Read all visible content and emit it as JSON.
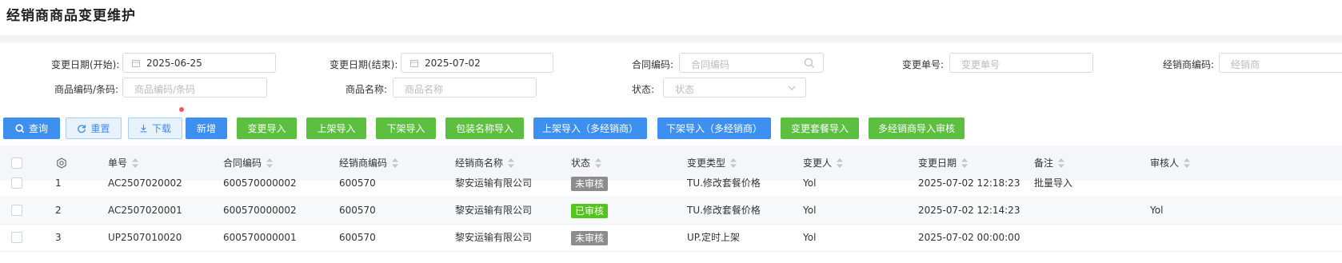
{
  "page": {
    "title": "经销商商品变更维护"
  },
  "filters": {
    "start_date": {
      "label": "变更日期(开始):",
      "value": "2025-06-25"
    },
    "end_date": {
      "label": "变更日期(结束):",
      "value": "2025-07-02"
    },
    "contract_code": {
      "label": "合同编码:",
      "placeholder": "合同编码"
    },
    "change_no": {
      "label": "变更单号:",
      "placeholder": "变更单号"
    },
    "dealer_code": {
      "label": "经销商编码:",
      "placeholder": "经销商"
    },
    "product_code": {
      "label": "商品编码/条码:",
      "placeholder": "商品编码/条码"
    },
    "product_name": {
      "label": "商品名称:",
      "placeholder": "商品名称"
    },
    "status": {
      "label": "状态:",
      "placeholder": "状态"
    }
  },
  "toolbar": {
    "query": "查询",
    "reset": "重置",
    "download": "下载",
    "add": "新增",
    "change_import": "变更导入",
    "shelf_on_import": "上架导入",
    "shelf_off_import": "下架导入",
    "package_name_import": "包装名称导入",
    "shelf_on_multi_import": "上架导入（多经销商）",
    "shelf_off_multi_import": "下架导入（多经销商）",
    "change_package_import": "变更套餐导入",
    "multi_dealer_import_review": "多经销商导入审核"
  },
  "table": {
    "headers": {
      "no": "单号",
      "contract": "合同编码",
      "dealer_code": "经销商编码",
      "dealer_name": "经销商名称",
      "status": "状态",
      "change_type": "变更类型",
      "changer": "变更人",
      "change_date": "变更日期",
      "remark": "备注",
      "reviewer": "审核人"
    },
    "rows": [
      {
        "idx": "1",
        "no": "AC2507020002",
        "contract": "600570000002",
        "dealer_code": "600570",
        "dealer_name": "黎安运输有限公司",
        "status": "未审核",
        "change_type": "TU.修改套餐价格",
        "changer": "Yol",
        "change_date": "2025-07-02 12:18:23",
        "remark": "批量导入",
        "reviewer": ""
      },
      {
        "idx": "2",
        "no": "AC2507020001",
        "contract": "600570000002",
        "dealer_code": "600570",
        "dealer_name": "黎安运输有限公司",
        "status": "已审核",
        "change_type": "TU.修改套餐价格",
        "changer": "Yol",
        "change_date": "2025-07-02 12:14:23",
        "remark": "",
        "reviewer": "Yol"
      },
      {
        "idx": "3",
        "no": "UP2507010020",
        "contract": "600570000001",
        "dealer_code": "600570",
        "dealer_name": "黎安运输有限公司",
        "status": "未审核",
        "change_type": "UP.定时上架",
        "changer": "Yol",
        "change_date": "2025-07-02 00:00:00",
        "remark": "",
        "reviewer": ""
      }
    ]
  },
  "colors": {
    "primary": "#3d8ff0",
    "success": "#5cbf3f",
    "pending_badge": "#8c8c8c",
    "approved_badge": "#52c41a",
    "header_bg": "#f4f6f9"
  },
  "icons": [
    "calendar-icon",
    "search-icon",
    "chevron-down-icon",
    "refresh-icon",
    "download-icon",
    "settings-icon",
    "sort-icon"
  ]
}
